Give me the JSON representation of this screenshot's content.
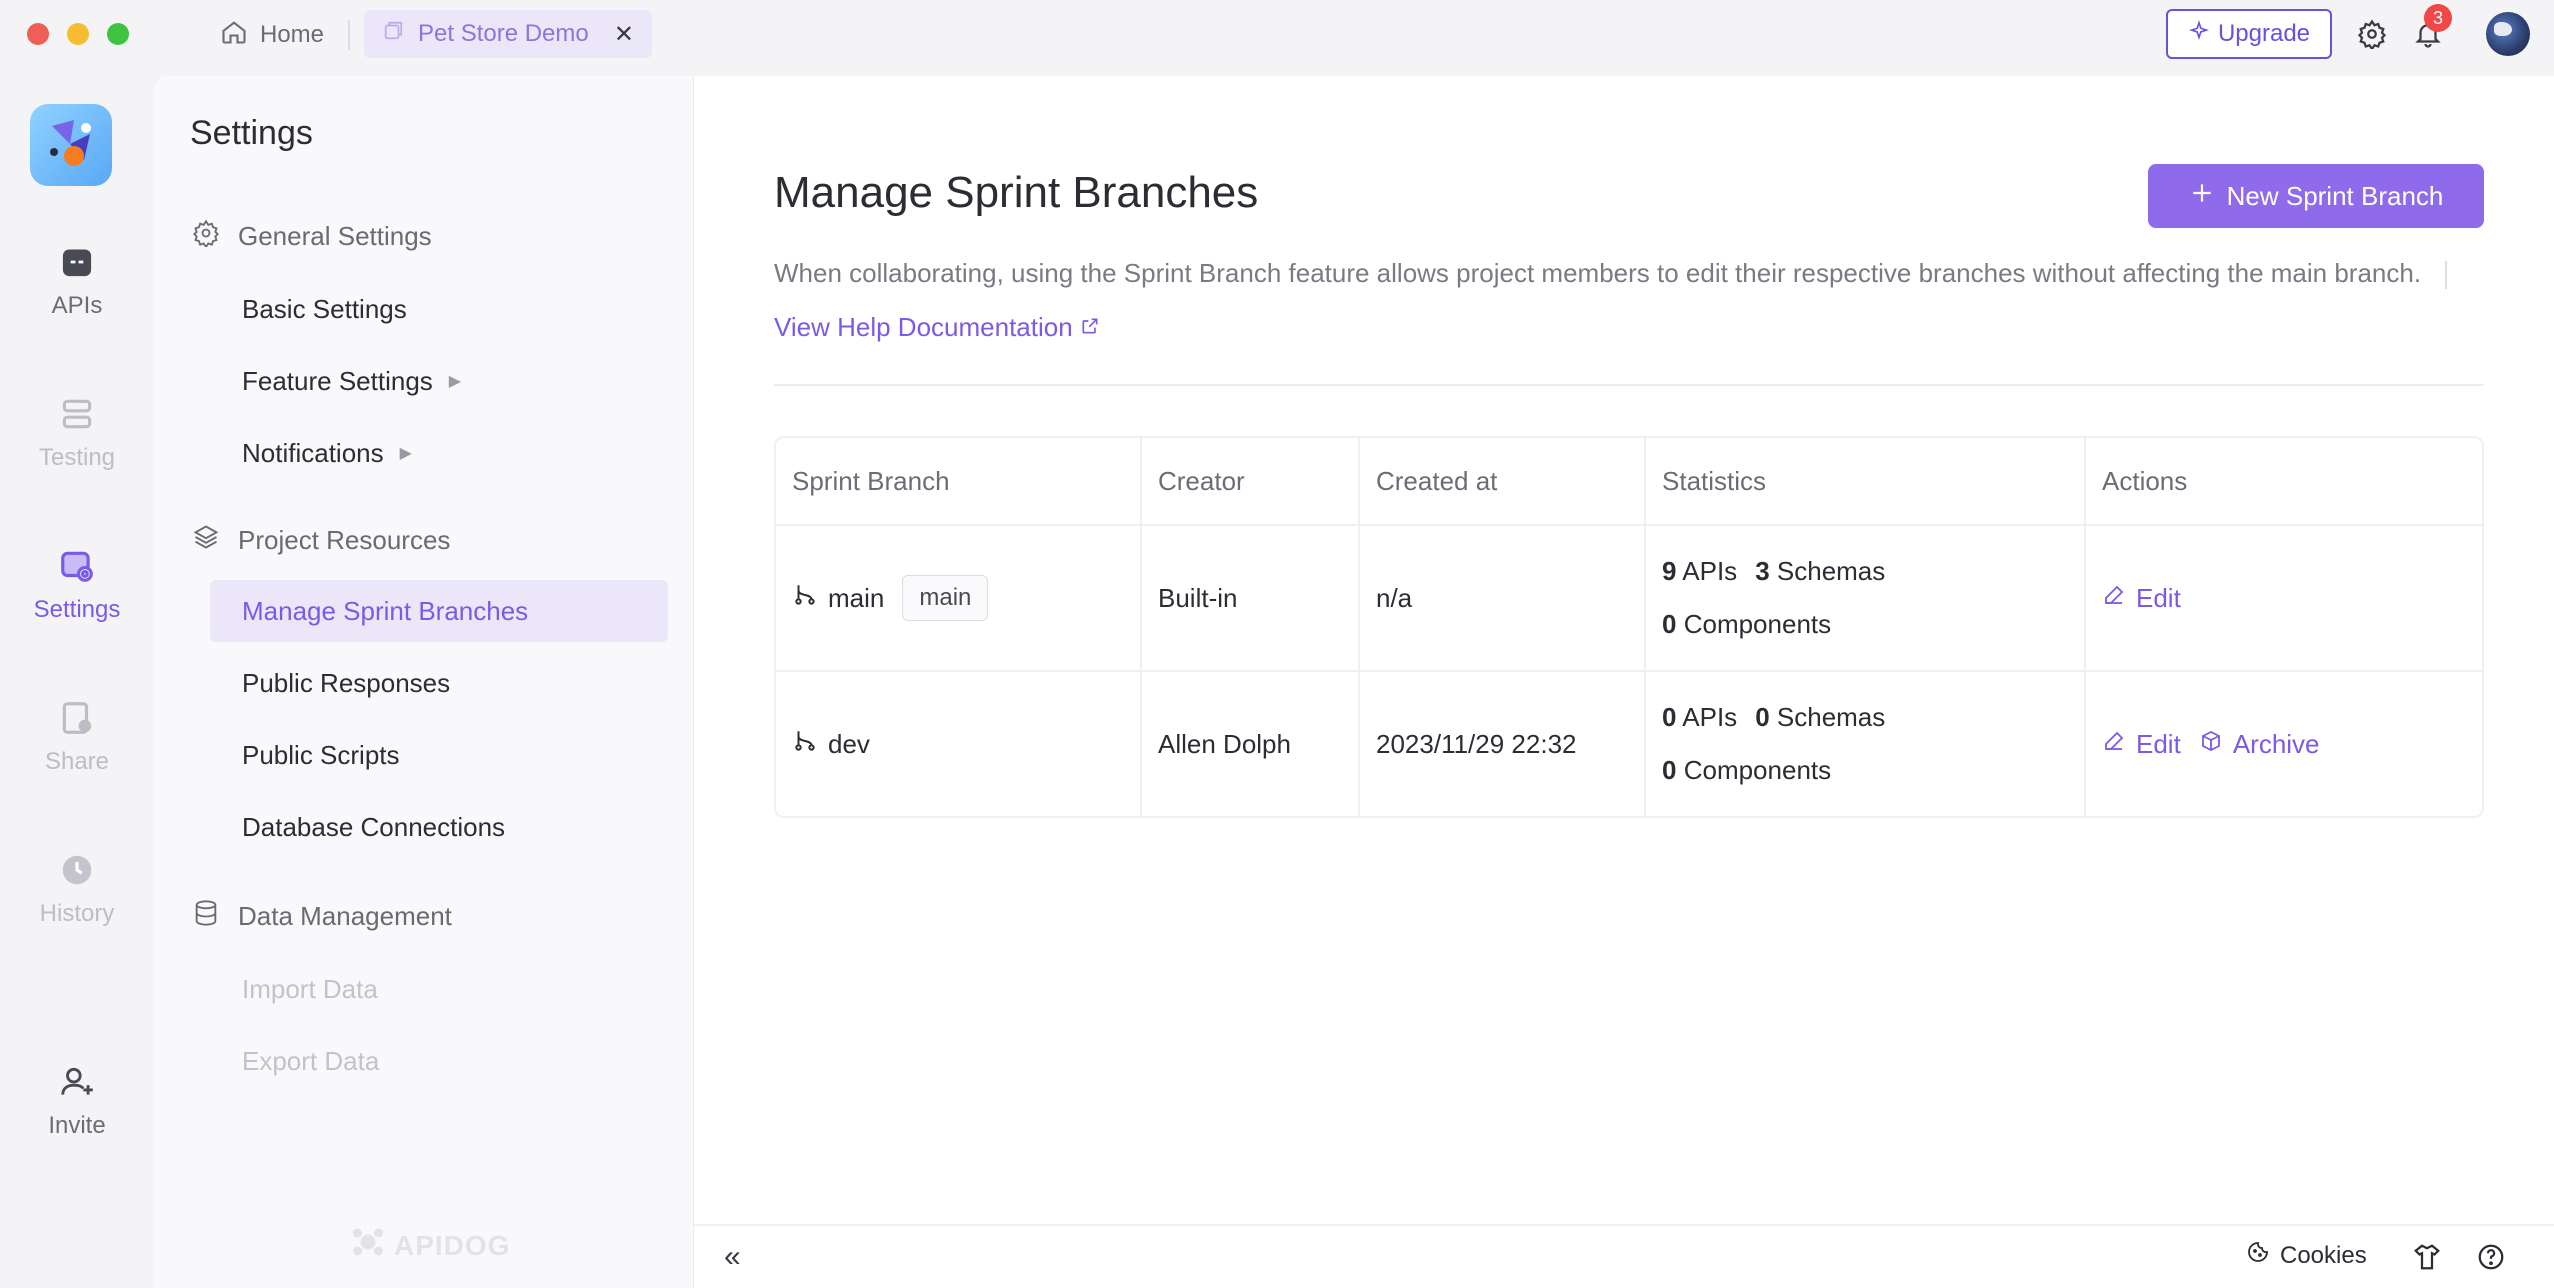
{
  "titlebar": {
    "home_tab": "Home",
    "project_tab": "Pet Store Demo",
    "upgrade_label": "Upgrade",
    "notification_count": "3"
  },
  "rail": {
    "items": [
      {
        "label": "APIs",
        "icon": "api-icon"
      },
      {
        "label": "Testing",
        "icon": "testing-icon"
      },
      {
        "label": "Settings",
        "icon": "settings-icon"
      },
      {
        "label": "Share",
        "icon": "share-icon"
      },
      {
        "label": "History",
        "icon": "history-icon"
      },
      {
        "label": "Invite",
        "icon": "invite-icon"
      }
    ]
  },
  "settings": {
    "title": "Settings",
    "general_group": "General Settings",
    "basic": "Basic Settings",
    "feature": "Feature Settings",
    "notifications": "Notifications",
    "resources_group": "Project Resources",
    "sprint": "Manage Sprint Branches",
    "responses": "Public Responses",
    "scripts": "Public Scripts",
    "database": "Database Connections",
    "data_group": "Data Management",
    "import": "Import Data",
    "export": "Export Data",
    "watermark": "APIDOG"
  },
  "main": {
    "title": "Manage Sprint Branches",
    "new_button": "New Sprint Branch",
    "description": "When collaborating, using the Sprint Branch feature allows project members to edit their respective branches without affecting the main branch.",
    "help_link": "View Help Documentation"
  },
  "table": {
    "headers": [
      "Sprint Branch",
      "Creator",
      "Created at",
      "Statistics",
      "Actions"
    ],
    "rows": [
      {
        "branch": "main",
        "tag": "main",
        "creator": "Built-in",
        "created": "n/a",
        "apis": "9",
        "apis_label": "APIs",
        "schemas": "3",
        "schemas_label": "Schemas",
        "components": "0",
        "components_label": "Components",
        "edit": "Edit"
      },
      {
        "branch": "dev",
        "creator": "Allen Dolph",
        "created": "2023/11/29 22:32",
        "apis": "0",
        "apis_label": "APIs",
        "schemas": "0",
        "schemas_label": "Schemas",
        "components": "0",
        "components_label": "Components",
        "edit": "Edit",
        "archive": "Archive"
      }
    ]
  },
  "footer": {
    "cookies": "Cookies"
  },
  "colors": {
    "accent": "#7a5ae6",
    "primary_button": "#8f6bec",
    "active_bg": "#ebe7f8"
  }
}
